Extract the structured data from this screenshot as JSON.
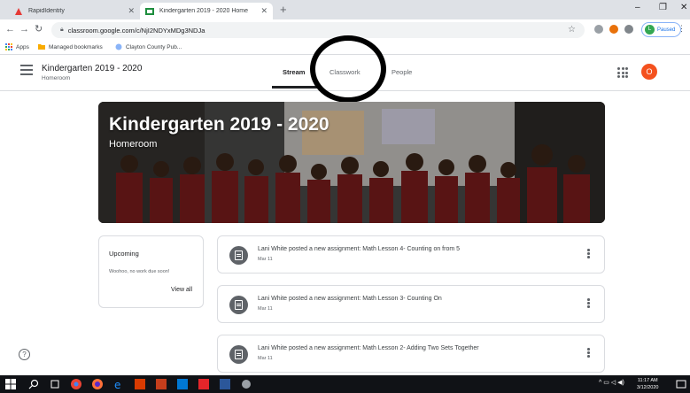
{
  "browser": {
    "tabs": [
      {
        "title": "RapidIdentity",
        "active": false
      },
      {
        "title": "Kindergarten 2019 - 2020 Home",
        "active": true
      }
    ],
    "url": "classroom.google.com/c/NjI2NDYxMDg3NDJa",
    "profile_status": "Paused",
    "profile_initial": "L"
  },
  "bookmarks": [
    {
      "label": "Apps",
      "icon": "apps-grid-icon"
    },
    {
      "label": "Managed bookmarks",
      "icon": "folder-icon"
    },
    {
      "label": "Clayton County Pub...",
      "icon": "globe-icon"
    }
  ],
  "classroom": {
    "course_title": "Kindergarten 2019 - 2020",
    "course_section": "Homeroom",
    "nav_tabs": [
      "Stream",
      "Classwork",
      "People"
    ],
    "active_tab": "Stream",
    "user_initial": "O"
  },
  "banner": {
    "title": "Kindergarten 2019 - 2020",
    "subtitle": "Homeroom"
  },
  "upcoming": {
    "title": "Upcoming",
    "empty_text": "Woohoo, no work due soon!",
    "view_all": "View all"
  },
  "posts": [
    {
      "text": "Lani White posted a new assignment: Math Lesson 4- Counting on from 5",
      "date": "Mar 11"
    },
    {
      "text": "Lani White posted a new assignment: Math Lesson 3- Counting On",
      "date": "Mar 11"
    },
    {
      "text": "Lani White posted a new assignment: Math Lesson 2- Adding Two Sets Together",
      "date": "Mar 11"
    }
  ],
  "taskbar": {
    "time": "11:17 AM",
    "date": "3/12/2020"
  },
  "colors": {
    "accent_orange": "#f4511e",
    "link_blue": "#1a73e8",
    "taskbar": "#101216"
  }
}
